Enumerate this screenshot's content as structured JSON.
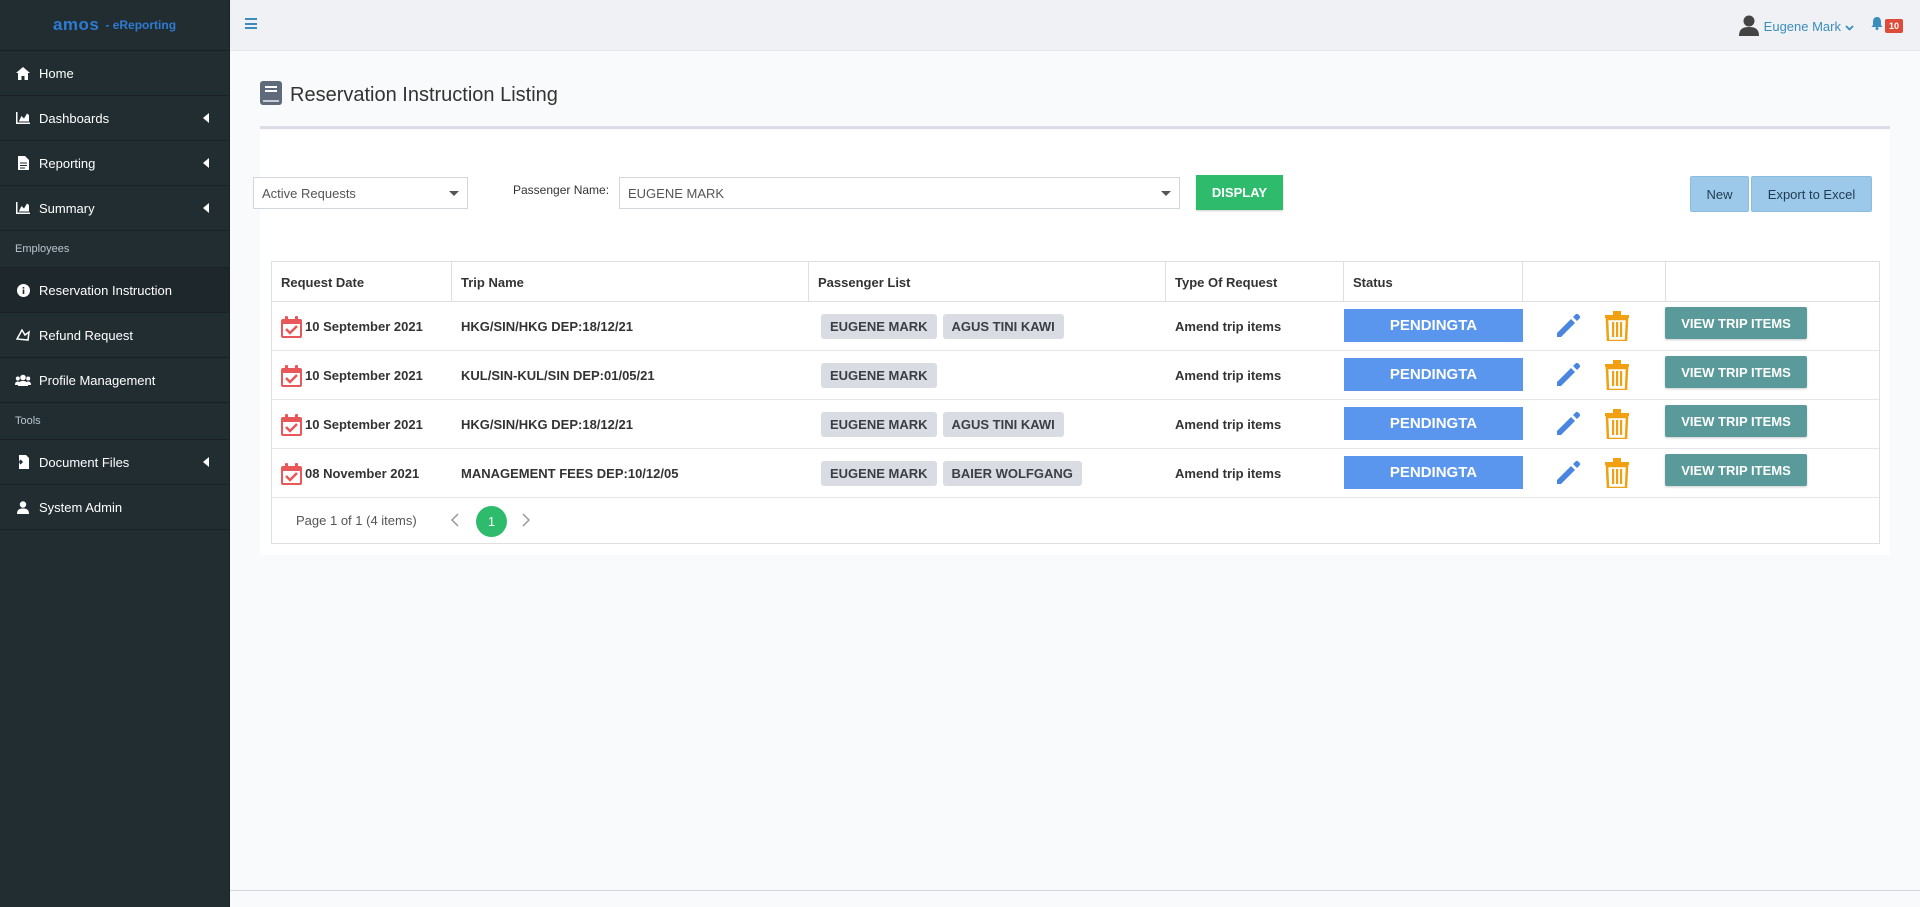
{
  "app": {
    "brand": "amos",
    "brand_sub": "- eReporting"
  },
  "sidebar": {
    "items": [
      {
        "label": "Home",
        "icon": "home-icon"
      },
      {
        "label": "Dashboards",
        "icon": "chart-icon"
      },
      {
        "label": "Reporting",
        "icon": "file-icon"
      },
      {
        "label": "Summary",
        "icon": "chart-icon"
      }
    ],
    "section_employees": "Employees",
    "employee_items": [
      {
        "label": "Reservation Instruction",
        "icon": "info-icon"
      },
      {
        "label": "Refund Request",
        "icon": "refund-icon"
      },
      {
        "label": "Profile Management",
        "icon": "users-icon"
      }
    ],
    "section_tools": "Tools",
    "tool_items": [
      {
        "label": "Document Files",
        "icon": "document-files-icon"
      },
      {
        "label": "System Admin",
        "icon": "user-icon"
      }
    ]
  },
  "topbar": {
    "user_name": "Eugene Mark",
    "notification_count": "10"
  },
  "page": {
    "title": "Reservation Instruction Listing"
  },
  "filters": {
    "request_filter": "Active Requests",
    "passenger_label": "Passenger Name:",
    "passenger_value": "EUGENE MARK",
    "display_label": "DISPLAY",
    "new_label": "New",
    "export_label": "Export to Excel"
  },
  "table": {
    "columns": [
      "Request Date",
      "Trip Name",
      "Passenger List",
      "Type Of Request",
      "Status"
    ],
    "rows": [
      {
        "date": "10 September 2021",
        "trip": "HKG/SIN/HKG DEP:18/12/21",
        "p1": "EUGENE MARK",
        "p2": "AGUS TINI KAWI",
        "type": "Amend trip items",
        "status": "PENDINGTA",
        "action": "VIEW TRIP ITEMS"
      },
      {
        "date": "10 September 2021",
        "trip": "KUL/SIN-KUL/SIN DEP:01/05/21",
        "p1": "EUGENE MARK",
        "p2": "",
        "type": "Amend trip items",
        "status": "PENDINGTA",
        "action": "VIEW TRIP ITEMS"
      },
      {
        "date": "10 September 2021",
        "trip": "HKG/SIN/HKG DEP:18/12/21",
        "p1": "EUGENE MARK",
        "p2": "AGUS TINI KAWI",
        "type": "Amend trip items",
        "status": "PENDINGTA",
        "action": "VIEW TRIP ITEMS"
      },
      {
        "date": "08 November 2021",
        "trip": "MANAGEMENT FEES DEP:10/12/05",
        "p1": "EUGENE MARK",
        "p2": "BAIER WOLFGANG",
        "type": "Amend trip items",
        "status": "PENDINGTA",
        "action": "VIEW TRIP ITEMS"
      }
    ]
  },
  "pager": {
    "info": "Page 1 of 1 (4 items)",
    "current": "1"
  },
  "colors": {
    "status": "#5b96ee",
    "display": "#2ebb6b",
    "view": "#5a9a9a",
    "edit": "#4a86e0",
    "delete": "#f0a010",
    "calendar": "#e8585a"
  }
}
